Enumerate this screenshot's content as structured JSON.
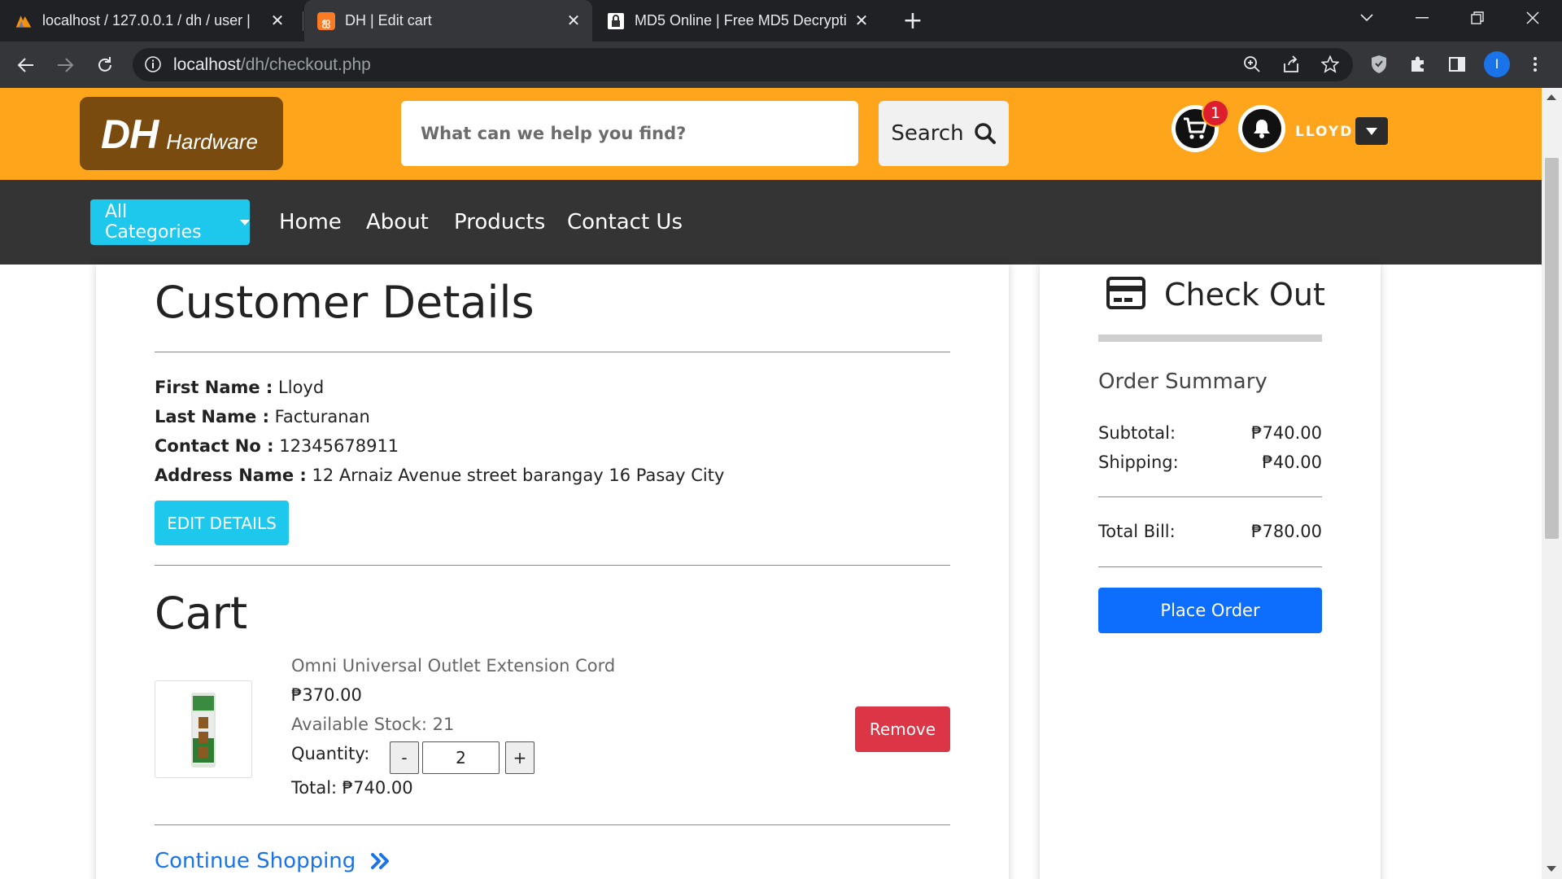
{
  "browser": {
    "tabs": [
      {
        "title": "localhost / 127.0.0.1 / dh / user |"
      },
      {
        "title": "DH | Edit cart"
      },
      {
        "title": "MD5 Online | Free MD5 Decrypti"
      }
    ],
    "address": {
      "host": "localhost",
      "path": "/dh/checkout.php"
    },
    "profile_initial": "I"
  },
  "header": {
    "logo_main": "DH",
    "logo_sub": "Hardware",
    "search_placeholder": "What can we help you find?",
    "search_button": "Search",
    "cart_count": "1",
    "username": "LLOYD"
  },
  "nav": {
    "all_categories": "All Categories",
    "links": [
      "Home",
      "About",
      "Products",
      "Contact Us"
    ]
  },
  "customer": {
    "heading": "Customer Details",
    "fields": [
      {
        "label": "First Name :",
        "value": "Lloyd"
      },
      {
        "label": "Last Name :",
        "value": "Facturanan"
      },
      {
        "label": "Contact No :",
        "value": "12345678911"
      },
      {
        "label": "Address Name :",
        "value": "12 Arnaiz Avenue street barangay 16 Pasay City"
      }
    ],
    "edit_button": "EDIT DETAILS"
  },
  "cart": {
    "heading": "Cart",
    "item": {
      "name": "Omni Universal Outlet Extension Cord",
      "price": "₱370.00",
      "stock": "Available Stock: 21",
      "quantity_label": "Quantity:",
      "minus": "-",
      "quantity": "2",
      "plus": "+",
      "total": "Total: ₱740.00",
      "remove": "Remove"
    },
    "continue": "Continue Shopping"
  },
  "checkout": {
    "title": "Check Out",
    "summary_title": "Order Summary",
    "subtotal_label": "Subtotal:",
    "subtotal": "₱740.00",
    "shipping_label": "Shipping:",
    "shipping": "₱40.00",
    "total_label": "Total Bill:",
    "total": "₱780.00",
    "place_order": "Place Order"
  },
  "colors": {
    "header_orange": "#ffa51c",
    "navbar_dark": "#343434",
    "cyan_button": "#1ec8ec",
    "remove_red": "#dc3545",
    "primary_blue": "#0d6efd",
    "logo_brown": "#7a4b0e"
  }
}
